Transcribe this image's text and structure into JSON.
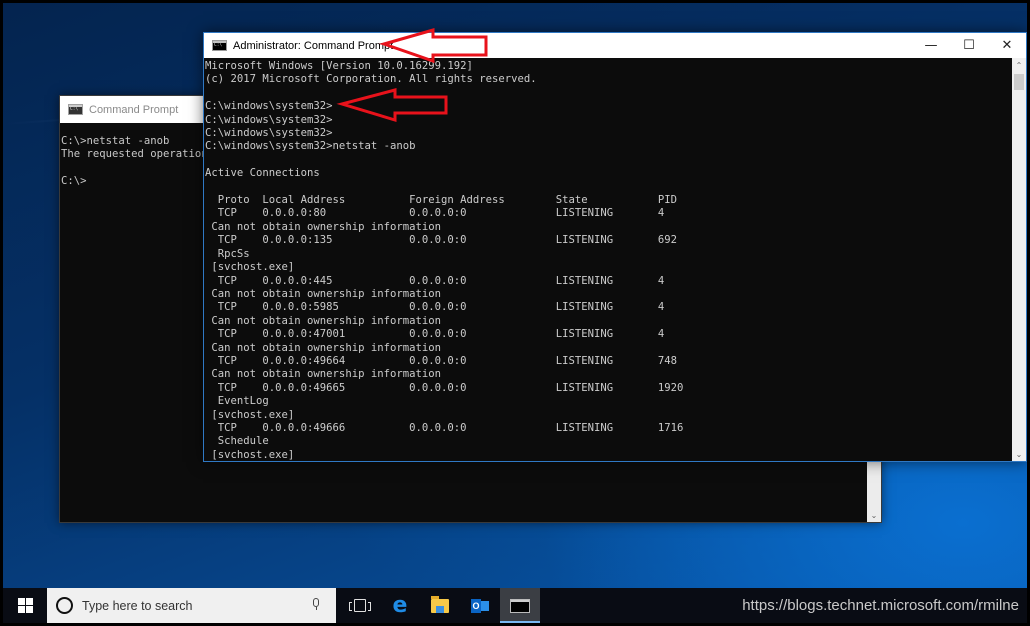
{
  "background_window": {
    "title": "Command Prompt",
    "icon": "cmd-icon",
    "console_lines": [
      "C:\\>netstat -anob",
      "The requested operation requires elevation.",
      "",
      "C:\\>"
    ]
  },
  "admin_window": {
    "title": "Administrator: Command Prompt",
    "icon": "cmd-icon",
    "controls": {
      "minimize": "—",
      "maximize": "☐",
      "close": "✕"
    },
    "console_lines": [
      "Microsoft Windows [Version 10.0.16299.192]",
      "(c) 2017 Microsoft Corporation. All rights reserved.",
      "",
      "C:\\windows\\system32>",
      "C:\\windows\\system32>",
      "C:\\windows\\system32>",
      "C:\\windows\\system32>netstat -anob",
      "",
      "Active Connections",
      "",
      "  Proto  Local Address          Foreign Address        State           PID",
      "  TCP    0.0.0.0:80             0.0.0.0:0              LISTENING       4",
      " Can not obtain ownership information",
      "  TCP    0.0.0.0:135            0.0.0.0:0              LISTENING       692",
      "  RpcSs",
      " [svchost.exe]",
      "  TCP    0.0.0.0:445            0.0.0.0:0              LISTENING       4",
      " Can not obtain ownership information",
      "  TCP    0.0.0.0:5985           0.0.0.0:0              LISTENING       4",
      " Can not obtain ownership information",
      "  TCP    0.0.0.0:47001          0.0.0.0:0              LISTENING       4",
      " Can not obtain ownership information",
      "  TCP    0.0.0.0:49664          0.0.0.0:0              LISTENING       748",
      " Can not obtain ownership information",
      "  TCP    0.0.0.0:49665          0.0.0.0:0              LISTENING       1920",
      "  EventLog",
      " [svchost.exe]",
      "  TCP    0.0.0.0:49666          0.0.0.0:0              LISTENING       1716",
      "  Schedule",
      " [svchost.exe]"
    ],
    "connections_table": {
      "headers": [
        "Proto",
        "Local Address",
        "Foreign Address",
        "State",
        "PID"
      ],
      "rows": [
        {
          "proto": "TCP",
          "local": "0.0.0.0:80",
          "foreign": "0.0.0.0:0",
          "state": "LISTENING",
          "pid": "4",
          "owner": "Can not obtain ownership information"
        },
        {
          "proto": "TCP",
          "local": "0.0.0.0:135",
          "foreign": "0.0.0.0:0",
          "state": "LISTENING",
          "pid": "692",
          "owner": "RpcSs [svchost.exe]"
        },
        {
          "proto": "TCP",
          "local": "0.0.0.0:445",
          "foreign": "0.0.0.0:0",
          "state": "LISTENING",
          "pid": "4",
          "owner": "Can not obtain ownership information"
        },
        {
          "proto": "TCP",
          "local": "0.0.0.0:5985",
          "foreign": "0.0.0.0:0",
          "state": "LISTENING",
          "pid": "4",
          "owner": "Can not obtain ownership information"
        },
        {
          "proto": "TCP",
          "local": "0.0.0.0:47001",
          "foreign": "0.0.0.0:0",
          "state": "LISTENING",
          "pid": "4",
          "owner": "Can not obtain ownership information"
        },
        {
          "proto": "TCP",
          "local": "0.0.0.0:49664",
          "foreign": "0.0.0.0:0",
          "state": "LISTENING",
          "pid": "748",
          "owner": "Can not obtain ownership information"
        },
        {
          "proto": "TCP",
          "local": "0.0.0.0:49665",
          "foreign": "0.0.0.0:0",
          "state": "LISTENING",
          "pid": "1920",
          "owner": "EventLog [svchost.exe]"
        },
        {
          "proto": "TCP",
          "local": "0.0.0.0:49666",
          "foreign": "0.0.0.0:0",
          "state": "LISTENING",
          "pid": "1716",
          "owner": "Schedule [svchost.exe]"
        }
      ]
    }
  },
  "annotations": {
    "arrow_color": "#e8121b",
    "arrows": [
      "points-to-admin-title",
      "points-to-prompt"
    ]
  },
  "taskbar": {
    "search_placeholder": "Type here to search",
    "icons": [
      "windows-start-icon",
      "cortana-icon",
      "microphone-icon",
      "task-view-icon",
      "edge-icon",
      "file-explorer-icon",
      "outlook-icon",
      "command-prompt-icon"
    ],
    "active_app": "Command Prompt",
    "accent": "#79b8f2"
  },
  "watermark": "https://blogs.technet.microsoft.com/rmilne"
}
